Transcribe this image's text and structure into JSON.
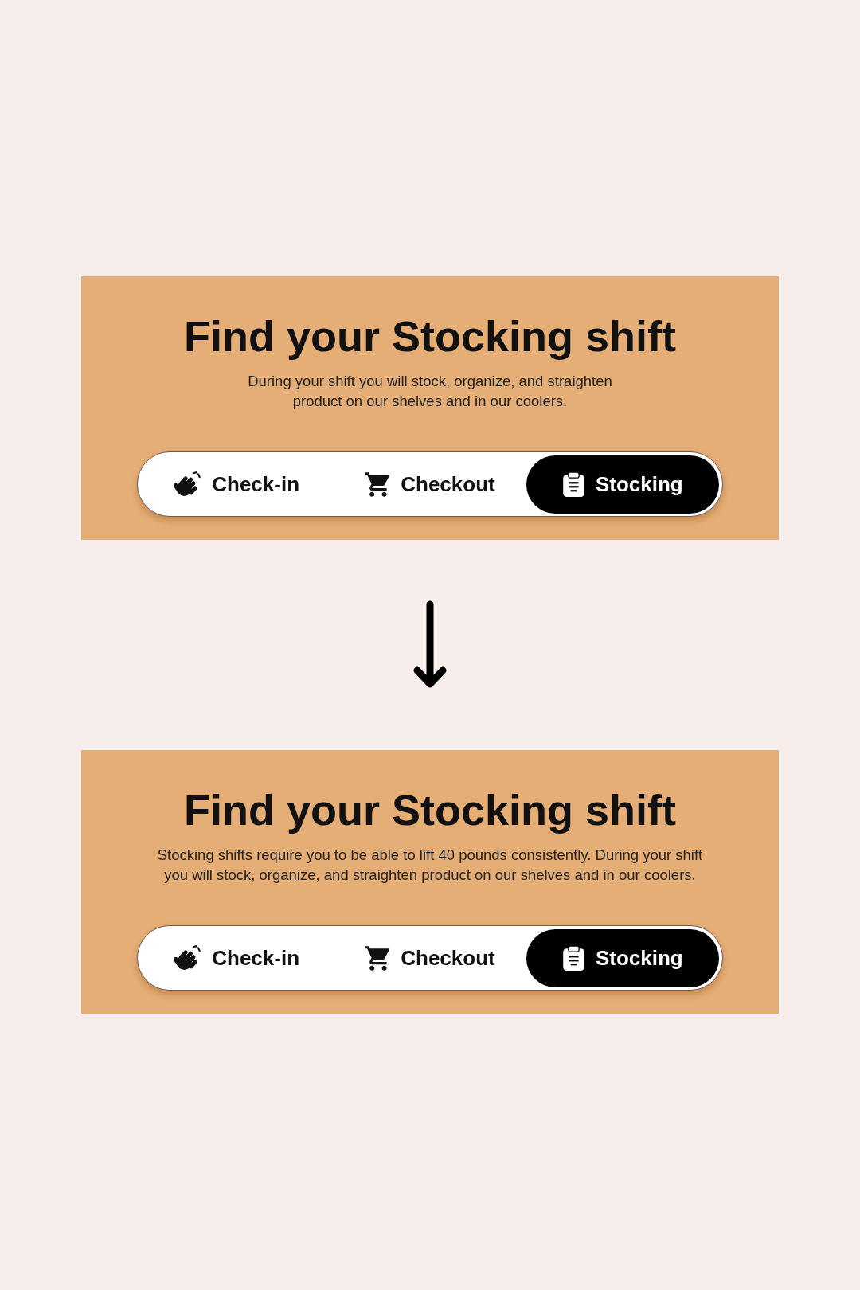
{
  "panels": [
    {
      "title": "Find your Stocking shift",
      "description": "During your shift you will stock, organize, and straighten product on our shelves and in our coolers.",
      "tabs": [
        {
          "kind": "checkin",
          "label": "Check-in",
          "selected": false
        },
        {
          "kind": "checkout",
          "label": "Checkout",
          "selected": false
        },
        {
          "kind": "stocking",
          "label": "Stocking",
          "selected": true
        }
      ]
    },
    {
      "title": "Find your Stocking shift",
      "description": "Stocking shifts require you to be able to lift 40 pounds consistently. During your shift you will stock, organize, and straighten product on our shelves and in our coolers.",
      "tabs": [
        {
          "kind": "checkin",
          "label": "Check-in",
          "selected": false
        },
        {
          "kind": "checkout",
          "label": "Checkout",
          "selected": false
        },
        {
          "kind": "stocking",
          "label": "Stocking",
          "selected": true
        }
      ]
    }
  ]
}
